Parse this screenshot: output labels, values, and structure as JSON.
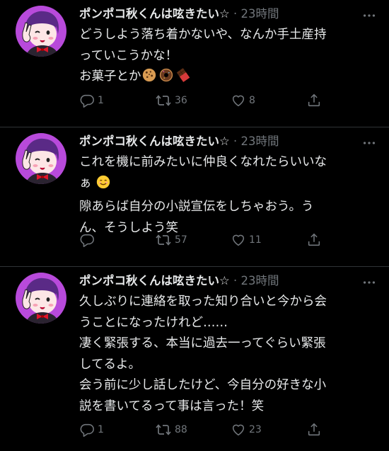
{
  "tweets": [
    {
      "display_name": "ポンポコ秋くんは呟きたい☆",
      "separator": "·",
      "time": "23時間",
      "lines": [
        "どうしよう落ち着かないや、なんか手土産持",
        "っていこうかな！",
        "お菓子とか"
      ],
      "emoji": [
        "cookie",
        "doughnut",
        "chocolate-bar"
      ],
      "replies": "1",
      "retweets": "36",
      "likes": "8"
    },
    {
      "display_name": "ポンポコ秋くんは呟きたい☆",
      "separator": "·",
      "time": "23時間",
      "lines": [
        "これを機に前みたいに仲良くなれたらいいな",
        "ぁ",
        "隙あらば自分の小説宣伝をしちゃおう。う",
        "ん、そうしよう笑"
      ],
      "emoji": [
        "smiling-face"
      ],
      "replies": "",
      "retweets": "57",
      "likes": "11"
    },
    {
      "display_name": "ポンポコ秋くんは呟きたい☆",
      "separator": "·",
      "time": "23時間",
      "lines": [
        "久しぶりに連絡を取った知り合いと今から会",
        "うことになったけれど……",
        "凄く緊張する、本当に過去一ってぐらい緊張",
        "してるよ。",
        "会う前に少し話したけど、今自分の好きな小",
        "説を書いてるって事は言った！笑"
      ],
      "emoji": [],
      "replies": "1",
      "retweets": "88",
      "likes": "23"
    }
  ],
  "colors": {
    "background": "#000000",
    "text": "#e7e9ea",
    "secondary": "#71767b",
    "divider": "#2f3336",
    "avatar_bg": "#b84adb"
  }
}
